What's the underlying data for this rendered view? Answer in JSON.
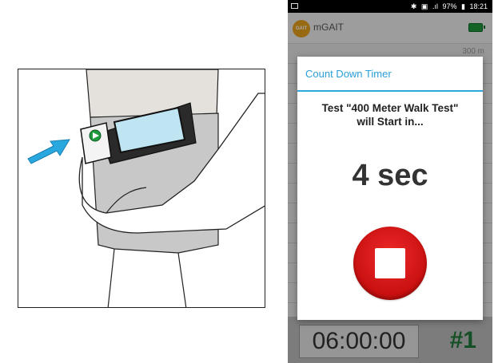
{
  "status_bar": {
    "icons": [
      "bluetooth-icon",
      "nfc-icon",
      "signal-icon",
      "battery-icon"
    ],
    "battery_percent": "97%",
    "time": "18:21"
  },
  "app": {
    "logo_text": "GAIT",
    "title": "mGAIT",
    "battery_color": "#1f9a3d"
  },
  "background_list": {
    "first_distance": "300 m"
  },
  "dialog": {
    "title": "Count Down Timer",
    "message_line1": "Test \"400 Meter Walk Test\"",
    "message_line2": "will Start in...",
    "countdown": "4 sec",
    "accent_color": "#2a9fd6",
    "stop_color": "#d11a1a"
  },
  "bottom": {
    "timer": "06:00:00",
    "counter": "#1",
    "counter_color": "#1f7a3a"
  }
}
